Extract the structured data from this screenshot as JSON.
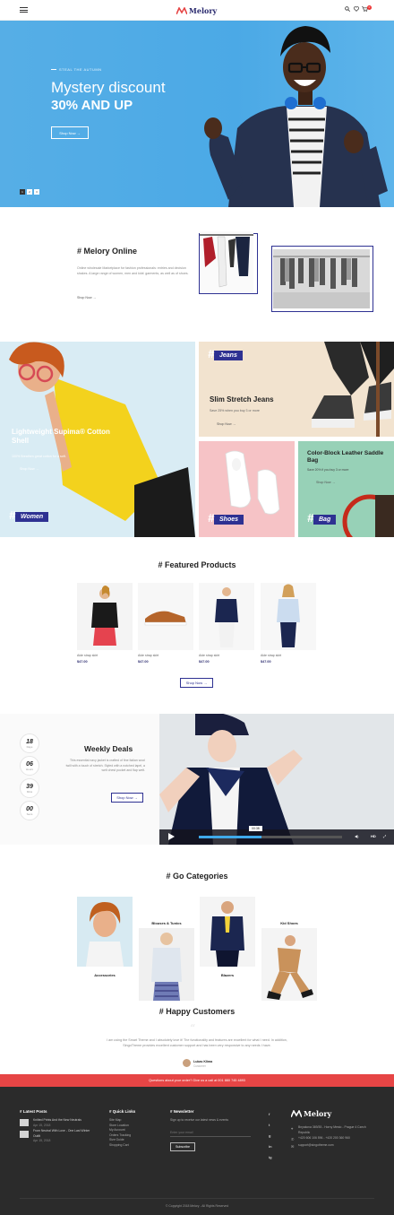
{
  "header": {
    "logo": "Melory",
    "cart_count": "0"
  },
  "hero": {
    "kicker": "STEAL THE AUTUMN",
    "title": "Mystery discount",
    "subtitle": "30% AND UP",
    "button": "Shop Now →",
    "slides": [
      "1",
      "2",
      "3"
    ]
  },
  "about": {
    "title": "# Melory Online",
    "text": "Online wholesale Marketplace for fashion professionals: entries and decision shakes. A large range of women, men and kids' garments, as well as of shoes.",
    "link": "Shop Now →"
  },
  "banners": {
    "women": {
      "title": "Lightweight Supima® Cotton Shell",
      "text": "100% Breathen great cotton for a soft.",
      "link": "Shop Now →",
      "tag": "Women"
    },
    "jeans": {
      "tag": "Jeans",
      "title": "Slim Stretch Jeans",
      "text": "Save 25% when you buy 3 or more",
      "link": "Shop Now →"
    },
    "shoes": {
      "tag": "Shoes"
    },
    "bag": {
      "title": "Color-Block Leather Saddle Bag",
      "text": "Save 20% if you buy 3 or more",
      "link": "Shop Now →",
      "tag": "Bag"
    }
  },
  "featured": {
    "title": "# Featured Products",
    "products": [
      {
        "name": "Aide strap skirt",
        "price": "$47.00"
      },
      {
        "name": "Aide strap skirt",
        "price": "$47.00"
      },
      {
        "name": "Aide strap skirt",
        "price": "$47.00"
      },
      {
        "name": "Aide strap skirt",
        "price": "$47.00"
      }
    ],
    "button": "Shop Now →"
  },
  "deals": {
    "countdown": [
      {
        "value": "18",
        "label": "Days"
      },
      {
        "value": "06",
        "label": "Hours"
      },
      {
        "value": "39",
        "label": "Mins"
      },
      {
        "value": "00",
        "label": "Secs"
      }
    ],
    "title": "Weekly Deals",
    "text": "This essential navy jacket is crafted of fine Italian wool twill with a touch of stretch. Styled with a notched lapel, a welt chest pocket and flap welt.",
    "button": "Shop Now →",
    "video_time": "00:38"
  },
  "categories": {
    "title": "# Go Categories",
    "items": [
      {
        "label": "Accessories"
      },
      {
        "label": "Blouses & Tunics"
      },
      {
        "label": "Blazers"
      },
      {
        "label": "Kid Shoes"
      }
    ]
  },
  "customers": {
    "title": "# Happy Customers",
    "quote": "I am using the Smart Theme and I absolutely love it! The functionality and features are excellent for what I need. In addition, SingoTheme provides excellent customer support and has been very responsive to any needs I have.",
    "name": "Lukas Klima",
    "role": "Customer"
  },
  "footer": {
    "redbar": "Questions about your order? Give us a call at 001 880 745 4893",
    "latest_title": "# Latest Posts",
    "posts": [
      {
        "title": "Knitted Prints And the New Neutrals",
        "date": "Apr 15, 2018"
      },
      {
        "title": "From Neutral With Love - One Last Winter Outfit",
        "date": "Apr 15, 2018"
      }
    ],
    "links_title": "# Quick Links",
    "links": [
      "Site Map",
      "Store Location",
      "My Account",
      "Orders Tracking",
      "Size Guide",
      "Shopping Cart"
    ],
    "newsletter_title": "# Newsletter",
    "newsletter_text": "Sign up to receive our latest news & events",
    "email_placeholder": "Enter your email",
    "subscribe": "Subscribe",
    "social": [
      "f",
      "t",
      "g",
      "in",
      "ig"
    ],
    "brand": "Melory",
    "address": "Bnyakova 369/35 - Horny Mesto - Prague 4 Czech Republic",
    "phone": "+420 606 106 596 - +420 200 360 960",
    "email": "support@singotheme.com",
    "copyright": "© Copyright 2018 Melory - All Rights Reserved"
  },
  "colors": {
    "accent": "#2e3192",
    "hero_bg": "#4ba9e6",
    "red": "#e64545",
    "footer_bg": "#2b2b2b"
  }
}
